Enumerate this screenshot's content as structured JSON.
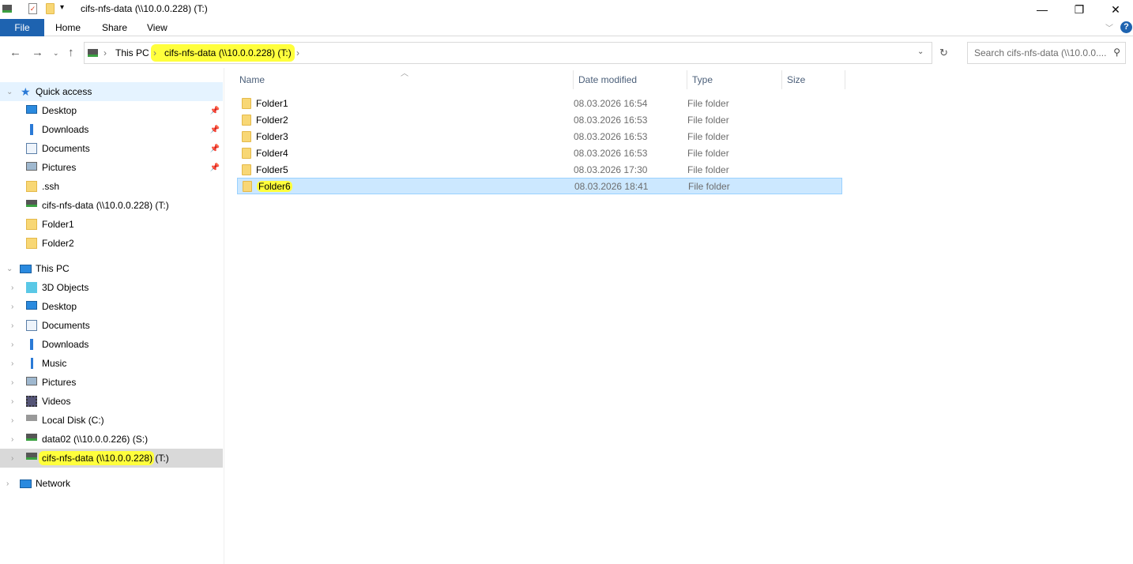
{
  "window": {
    "title": "cifs-nfs-data (\\\\10.0.0.228) (T:)"
  },
  "ribbon": {
    "tabs": [
      "File",
      "Home",
      "Share",
      "View"
    ]
  },
  "address": {
    "crumbs": [
      "This PC",
      "cifs-nfs-data (\\\\10.0.0.228) (T:)"
    ]
  },
  "search": {
    "placeholder": "Search cifs-nfs-data (\\\\10.0.0...."
  },
  "columns": [
    "Name",
    "Date modified",
    "Type",
    "Size"
  ],
  "files": [
    {
      "name": "Folder1",
      "date": "08.03.2026 16:54",
      "type": "File folder"
    },
    {
      "name": "Folder2",
      "date": "08.03.2026 16:53",
      "type": "File folder"
    },
    {
      "name": "Folder3",
      "date": "08.03.2026 16:53",
      "type": "File folder"
    },
    {
      "name": "Folder4",
      "date": "08.03.2026 16:53",
      "type": "File folder"
    },
    {
      "name": "Folder5",
      "date": "08.03.2026 17:30",
      "type": "File folder"
    },
    {
      "name": "Folder6",
      "date": "08.03.2026 18:41",
      "type": "File folder"
    }
  ],
  "sidebar": {
    "quick_access": "Quick access",
    "quick": [
      {
        "label": "Desktop",
        "icon": "pc",
        "pin": true
      },
      {
        "label": "Downloads",
        "icon": "down",
        "pin": true
      },
      {
        "label": "Documents",
        "icon": "doc",
        "pin": true
      },
      {
        "label": "Pictures",
        "icon": "pic",
        "pin": true
      },
      {
        "label": ".ssh",
        "icon": "folder"
      },
      {
        "label": "cifs-nfs-data (\\\\10.0.0.228) (T:)",
        "icon": "drive"
      },
      {
        "label": "Folder1",
        "icon": "folder"
      },
      {
        "label": "Folder2",
        "icon": "folder"
      }
    ],
    "this_pc": "This PC",
    "pc": [
      {
        "label": "3D Objects",
        "icon": "cube"
      },
      {
        "label": "Desktop",
        "icon": "pc"
      },
      {
        "label": "Documents",
        "icon": "doc"
      },
      {
        "label": "Downloads",
        "icon": "down"
      },
      {
        "label": "Music",
        "icon": "music"
      },
      {
        "label": "Pictures",
        "icon": "pic"
      },
      {
        "label": "Videos",
        "icon": "video"
      },
      {
        "label": "Local Disk (C:)",
        "icon": "disk"
      },
      {
        "label": "data02 (\\\\10.0.0.226) (S:)",
        "icon": "drive"
      },
      {
        "label": "cifs-nfs-data (\\\\10.0.0.228) (T:)",
        "icon": "drive",
        "selected": true
      }
    ],
    "network": "Network"
  }
}
